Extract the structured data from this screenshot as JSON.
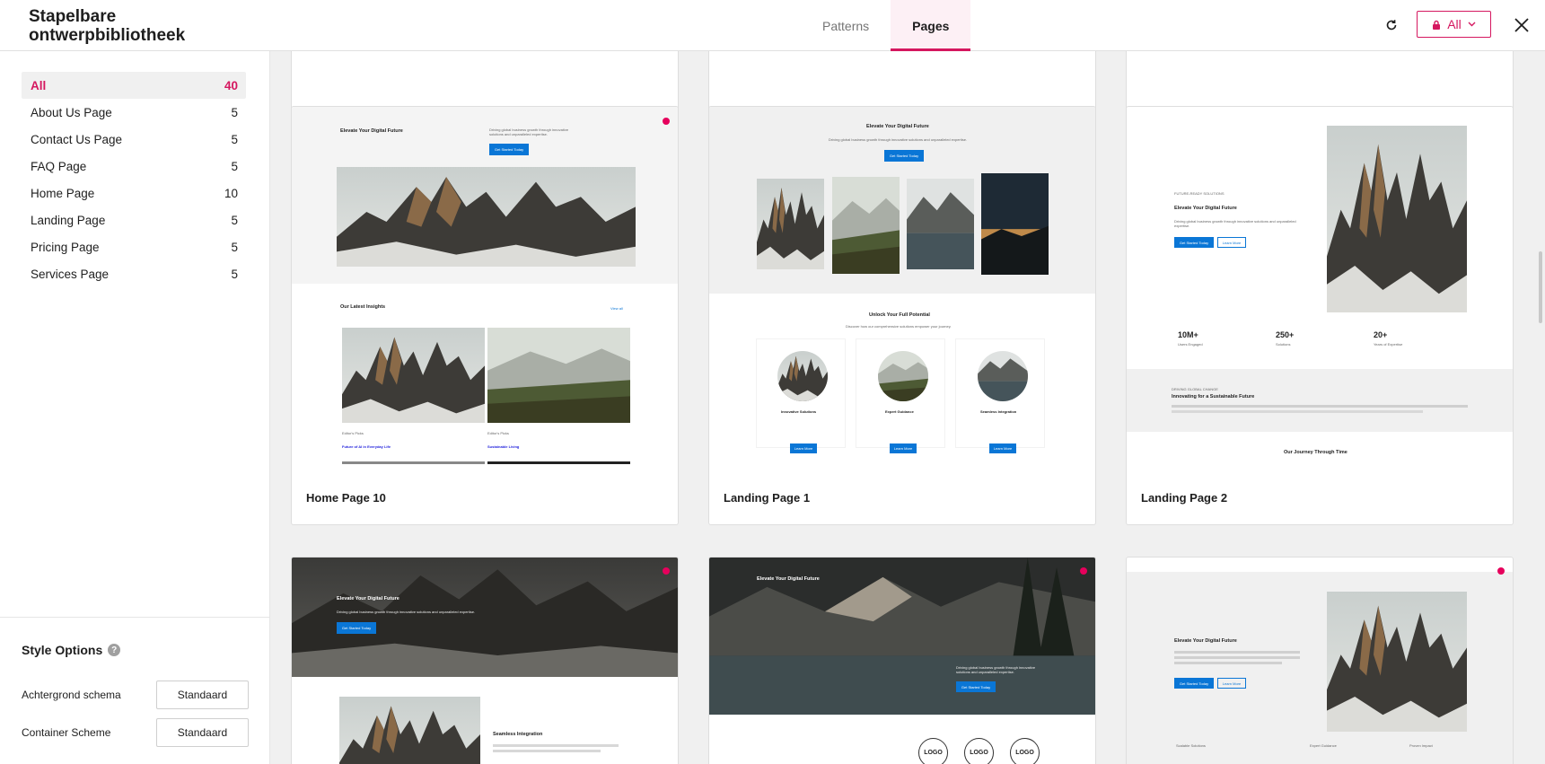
{
  "header": {
    "title_line1": "Stapelbare",
    "title_line2": "ontwerpbibliotheek",
    "tabs": [
      {
        "label": "Patterns"
      },
      {
        "label": "Pages"
      }
    ],
    "filter_label": "All"
  },
  "sidebar": {
    "categories": [
      {
        "label": "All",
        "count": "40"
      },
      {
        "label": "About Us Page",
        "count": "5"
      },
      {
        "label": "Contact Us Page",
        "count": "5"
      },
      {
        "label": "FAQ Page",
        "count": "5"
      },
      {
        "label": "Home Page",
        "count": "10"
      },
      {
        "label": "Landing Page",
        "count": "5"
      },
      {
        "label": "Pricing Page",
        "count": "5"
      },
      {
        "label": "Services Page",
        "count": "5"
      }
    ],
    "style_options": {
      "title": "Style Options",
      "background_label": "Achtergrond schema",
      "background_value": "Standaard",
      "container_label": "Container Scheme",
      "container_value": "Standaard"
    }
  },
  "cards": [
    {
      "label": "Home Page 10",
      "hero_title": "Elevate Your Digital Future",
      "hero_text": "Driving global business growth through innovative solutions and unparalleled expertise.",
      "cta": "Get Started Today",
      "section_title": "Our Latest Insights",
      "view_all": "View all",
      "posts": [
        {
          "meta": "Editor's Picks",
          "title": "Future of AI in Everyday Life"
        },
        {
          "meta": "Editor's Picks",
          "title": "Sustainable Living"
        }
      ]
    },
    {
      "label": "Landing Page 1",
      "hero_title": "Elevate Your Digital Future",
      "hero_text": "Driving global business growth through innovative solutions and unparalleled expertise.",
      "cta": "Get Started Today",
      "section_title": "Unlock Your Full Potential",
      "section_text": "Discover how our comprehensive solutions empower your journey.",
      "features": [
        {
          "title": "Innovative Solutions",
          "btn": "Learn More"
        },
        {
          "title": "Expert Guidance",
          "btn": "Learn More"
        },
        {
          "title": "Seamless Integration",
          "btn": "Learn More"
        }
      ]
    },
    {
      "label": "Landing Page 2",
      "eyebrow": "FUTURE-READY SOLUTIONS",
      "hero_title": "Elevate Your Digital Future",
      "hero_text": "Driving global business growth through innovative solutions and unparalleled expertise.",
      "cta": "Get Started Today",
      "cta2": "Learn More",
      "stats": [
        {
          "value": "10M+",
          "label": "Users Engaged"
        },
        {
          "value": "250+",
          "label": "Solutions"
        },
        {
          "value": "20+",
          "label": "Years of Expertise"
        }
      ],
      "band_eyebrow": "DRIVING GLOBAL CHANGE",
      "band_title": "Innovating for a Sustainable Future",
      "journey_title": "Our Journey Through Time"
    },
    {
      "hero_title": "Elevate Your Digital Future",
      "hero_text": "Driving global business growth through innovative solutions and unparalleled expertise.",
      "cta": "Get Started Today",
      "section_title": "Seamless Integration"
    },
    {
      "hero_title": "Elevate Your Digital Future",
      "hero_text": "Driving global business growth through innovative solutions and unparalleled expertise.",
      "cta": "Get Started Today",
      "logos": [
        "LOGO",
        "LOGO",
        "LOGO"
      ]
    },
    {
      "hero_title": "Elevate Your Digital Future",
      "cta": "Get Started Today",
      "cta2": "Learn More",
      "footer_items": [
        "Scalable Solutions",
        "Expert Guidance",
        "Proven Impact"
      ]
    }
  ]
}
